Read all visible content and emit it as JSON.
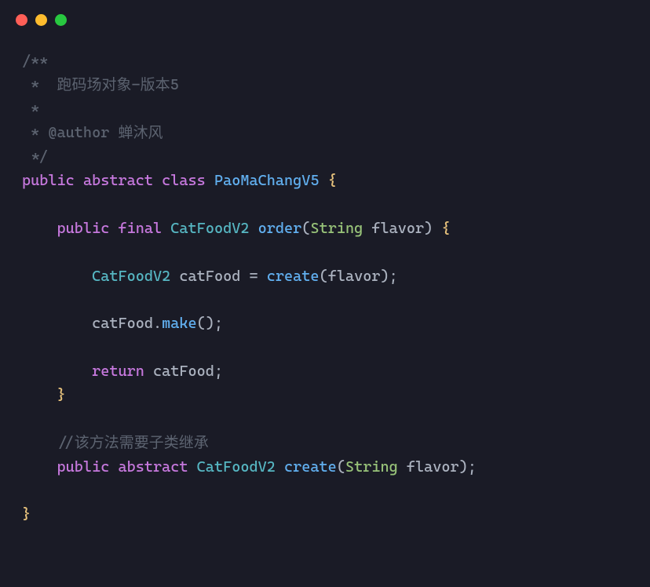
{
  "comments": {
    "line1": "/**",
    "line2": " *  跑码场对象-版本5",
    "line3": " *",
    "line4": " * @author 蝉沐风",
    "line5": " */",
    "inline": "//该方法需要子类继承"
  },
  "code": {
    "k_public": "public",
    "k_abstract": "abstract",
    "k_class": "class",
    "k_final": "final",
    "k_return": "return",
    "class_name": "PaoMaChangV5",
    "type_catfood": "CatFoodV2",
    "type_string": "String",
    "m_order": "order",
    "m_create": "create",
    "m_make": "make",
    "v_catfood": "catFood",
    "p_flavor": "flavor",
    "space": " ",
    "lbrace": "{",
    "rbrace": "}",
    "lparen": "(",
    "rparen": ")",
    "semi": ";",
    "eq": "=",
    "dot": "."
  }
}
